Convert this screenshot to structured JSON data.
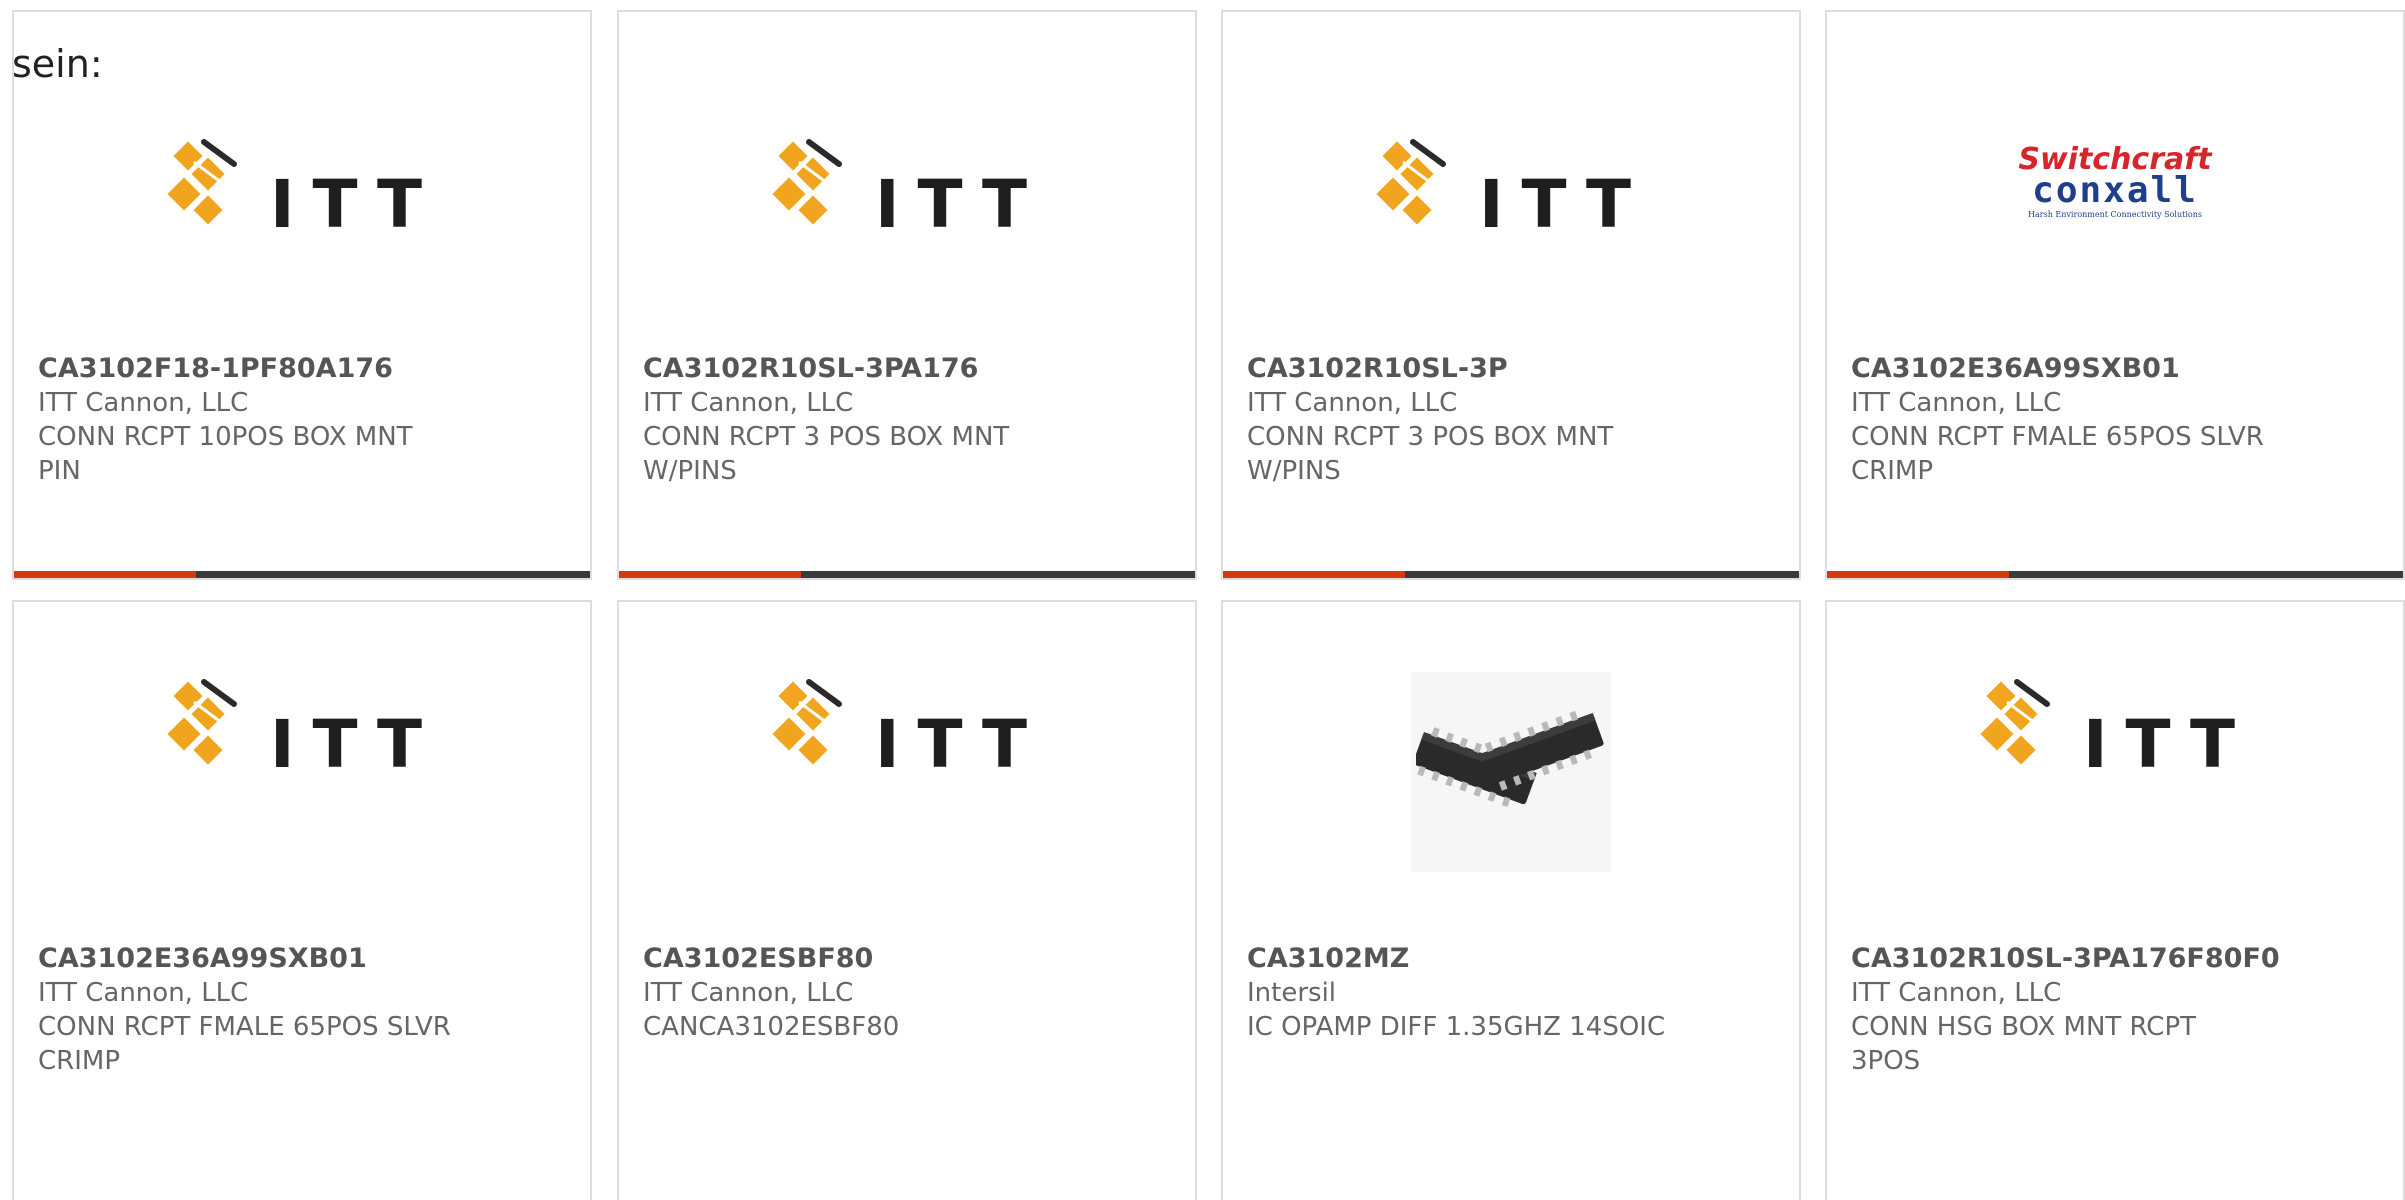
{
  "prefix_text": "sein:",
  "accent_color": "#d63a0c",
  "brand_itt": "ITT",
  "switchcraft": {
    "line1": "Switchcraft",
    "line2": "conxall",
    "line3": "Harsh Environment Connectivity Solutions"
  },
  "cards": [
    {
      "part": "CA3102F18-1PF80A176",
      "manufacturer": "ITT Cannon, LLC",
      "description": "CONN RCPT 10POS BOX MNT PIN",
      "logo": "itt-logo"
    },
    {
      "part": "CA3102R10SL-3PA176",
      "manufacturer": "ITT Cannon, LLC",
      "description": "CONN RCPT 3 POS BOX MNT W/PINS",
      "logo": "itt-logo"
    },
    {
      "part": "CA3102R10SL-3P",
      "manufacturer": "ITT Cannon, LLC",
      "description": "CONN RCPT 3 POS BOX MNT W/PINS",
      "logo": "itt-logo"
    },
    {
      "part": "CA3102E36A99SXB01",
      "manufacturer": "ITT Cannon, LLC",
      "description": "CONN RCPT FMALE 65POS SLVR CRIMP",
      "logo": "switchcraft-conxall-logo"
    },
    {
      "part": "CA3102E36A99SXB01",
      "manufacturer": "ITT Cannon, LLC",
      "description": "CONN RCPT FMALE 65POS SLVR CRIMP",
      "logo": "itt-logo"
    },
    {
      "part": "CA3102ESBF80",
      "manufacturer": "ITT Cannon, LLC",
      "description": "CANCA3102ESBF80",
      "logo": "itt-logo"
    },
    {
      "part": "CA3102MZ",
      "manufacturer": "Intersil",
      "description": "IC OPAMP DIFF 1.35GHZ 14SOIC",
      "logo": "soic-chip-image"
    },
    {
      "part": "CA3102R10SL-3PA176F80F0",
      "manufacturer": "ITT Cannon, LLC",
      "description": "CONN HSG BOX MNT RCPT 3POS",
      "logo": "itt-logo"
    }
  ]
}
